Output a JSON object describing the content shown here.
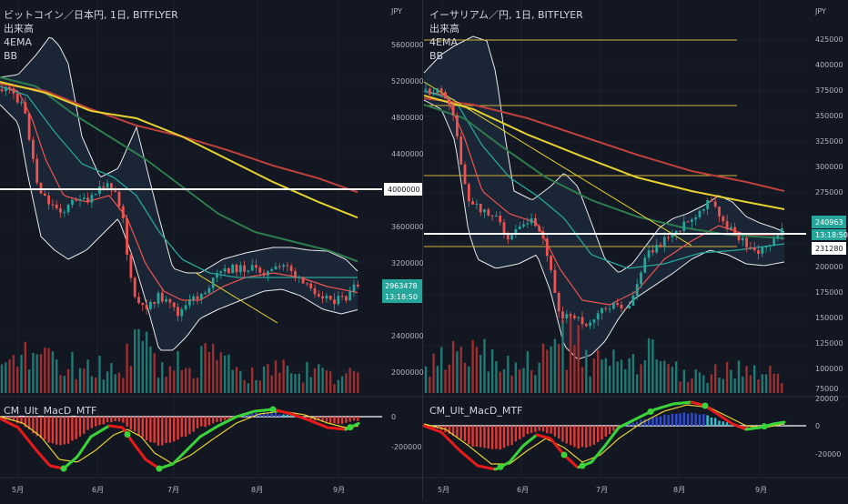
{
  "colors": {
    "bg": "#131722",
    "grid": "#1e222d",
    "up": "#26a69a",
    "down": "#ef5350",
    "vol_up": "#1f7a73",
    "vol_down": "#9c2f2f",
    "ema1": "#ef5350",
    "ema2": "#26a69a",
    "ema3": "#e6d32f",
    "ema4": "#c0413c",
    "ema_green": "#2e7d4f",
    "bb": "#e8e8e8",
    "bb_fill": "#1d2b3d",
    "hline": "#ffffff",
    "yline": "#d4b43a",
    "macd_up": "#3ad33a",
    "macd_down": "#e61b1b",
    "signal": "#e6d32f",
    "hist_pos": "#26c6da",
    "hist_neg": "#e53935",
    "hist_blue": "#2c4bd8",
    "price_tag": "#26a69a"
  },
  "panels": [
    {
      "id": "btc",
      "title": "ビットコイン／日本円, 1日, BITFLYER",
      "legend": [
        "出来高",
        "4EMA",
        "BB"
      ],
      "unit": "JPY",
      "y_ticks": [
        "5600000",
        "5200000",
        "4800000",
        "4400000",
        "4000000",
        "3600000",
        "3200000",
        "2400000",
        "2000000"
      ],
      "hline_label": "4000000",
      "price_label": "2963478",
      "countdown": "13:18:50",
      "indicator_name": "CM_Ult_MacD_MTF",
      "indicator_ticks": [
        "0",
        "-200000"
      ],
      "x_labels": [
        "5月",
        "6月",
        "7月",
        "8月",
        "9月"
      ]
    },
    {
      "id": "eth",
      "title": "イーサリアム／円, 1日, BITFLYER",
      "legend": [
        "出来高",
        "4EMA",
        "BB"
      ],
      "unit": "JPY",
      "y_ticks": [
        "425000",
        "400000",
        "375000",
        "350000",
        "325000",
        "300000",
        "275000",
        "250000",
        "225000",
        "200000",
        "175000",
        "150000",
        "125000",
        "100000",
        "75000"
      ],
      "hline_label": "231280",
      "price_label": "240963",
      "countdown": "13:18:50",
      "indicator_name": "CM_Ult_MacD_MTF",
      "indicator_ticks": [
        "20000",
        "0",
        "-20000"
      ],
      "x_labels": [
        "5月",
        "6月",
        "7月",
        "8月",
        "9月"
      ]
    }
  ],
  "chart_data": [
    {
      "type": "line",
      "series": [
        {
          "name": "",
          "x": [
            "5月",
            "6月",
            "7月",
            "8月",
            "9月"
          ],
          "values": [
            5000000,
            3800000,
            2700000,
            3200000,
            2963478
          ]
        }
      ],
      "title": "ビットコイン／日本円, 1日, BITFLYER",
      "xlabel": "",
      "ylabel": "JPY",
      "ylim": [
        1900000,
        5800000
      ],
      "grid": true,
      "legend_placement": "top-left"
    },
    {
      "type": "line",
      "series": [
        {
          "name": "",
          "x": [
            "5月",
            "6月",
            "7月",
            "8月",
            "9月"
          ],
          "values": [
            360000,
            230000,
            150000,
            250000,
            240963
          ]
        }
      ],
      "title": "イーサリアム／円, 1日, BITFLYER",
      "xlabel": "",
      "ylabel": "JPY",
      "ylim": [
        70000,
        435000
      ],
      "grid": true,
      "legend_placement": "top-left"
    }
  ]
}
